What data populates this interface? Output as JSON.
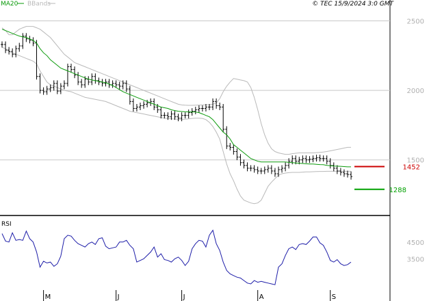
{
  "header": {
    "legend_ma20": "MA20",
    "legend_bbands": "BBands",
    "source": "© TEC 15/9/2024 3:0 GMT"
  },
  "colors": {
    "price": "#000000",
    "ma20": "#0a9a0a",
    "bbands": "#b9b9b9",
    "rsi": "#1c1ca8",
    "resistance": "#cc0000",
    "support": "#00a000",
    "grid": "#c8c8c8",
    "axis_text": "#b0b0b0"
  },
  "chart_data": [
    {
      "type": "ohlc",
      "name": "price",
      "ylim": [
        1100,
        2650
      ],
      "y_ticks": [
        {
          "value": 2500,
          "label": "2500"
        },
        {
          "value": 2000,
          "label": "2000"
        },
        {
          "value": 1500,
          "label": "1500"
        }
      ],
      "x_labels": [
        {
          "label": "M",
          "index": 12
        },
        {
          "label": "J",
          "index": 33
        },
        {
          "label": "J",
          "index": 52
        },
        {
          "label": "A",
          "index": 74
        },
        {
          "label": "S",
          "index": 95
        }
      ],
      "closes": [
        2330,
        2290,
        2280,
        2260,
        2300,
        2320,
        2390,
        2370,
        2360,
        2340,
        2100,
        2000,
        1990,
        2010,
        2020,
        2050,
        1995,
        2030,
        2050,
        2170,
        2150,
        2110,
        2060,
        2040,
        2080,
        2060,
        2100,
        2070,
        2060,
        2050,
        2060,
        2040,
        2050,
        2040,
        2030,
        2050,
        2010,
        1920,
        1870,
        1880,
        1890,
        1900,
        1910,
        1920,
        1880,
        1860,
        1820,
        1820,
        1810,
        1830,
        1810,
        1800,
        1820,
        1820,
        1840,
        1850,
        1860,
        1870,
        1870,
        1880,
        1880,
        1920,
        1890,
        1880,
        1720,
        1600,
        1590,
        1560,
        1520,
        1480,
        1460,
        1440,
        1440,
        1430,
        1420,
        1420,
        1430,
        1440,
        1420,
        1400,
        1430,
        1440,
        1460,
        1490,
        1510,
        1490,
        1500,
        1510,
        1500,
        1505,
        1510,
        1515,
        1510,
        1510,
        1490,
        1460,
        1440,
        1420,
        1410,
        1400,
        1395,
        1380
      ],
      "ma20": [
        2440,
        2430,
        2420,
        2410,
        2400,
        2390,
        2385,
        2380,
        2370,
        2360,
        2340,
        2300,
        2270,
        2250,
        2220,
        2200,
        2180,
        2160,
        2150,
        2140,
        2130,
        2120,
        2110,
        2100,
        2090,
        2080,
        2075,
        2070,
        2065,
        2060,
        2055,
        2045,
        2035,
        2020,
        2005,
        1990,
        1980,
        1970,
        1960,
        1950,
        1940,
        1930,
        1920,
        1910,
        1900,
        1890,
        1880,
        1875,
        1870,
        1860,
        1855,
        1850,
        1848,
        1846,
        1845,
        1845,
        1845,
        1840,
        1830,
        1820,
        1810,
        1790,
        1760,
        1730,
        1700,
        1680,
        1650,
        1610,
        1590,
        1570,
        1550,
        1530,
        1510,
        1500,
        1490,
        1485,
        1485,
        1485,
        1485,
        1485,
        1485,
        1485,
        1485,
        1482,
        1480,
        1478,
        1476,
        1474,
        1472,
        1470,
        1470,
        1468,
        1466,
        1465,
        1460,
        1458,
        1456,
        1455,
        1454,
        1452,
        1450,
        1450
      ],
      "bb_upper": [
        2450,
        2430,
        2400,
        2400,
        2420,
        2440,
        2450,
        2460,
        2460,
        2460,
        2450,
        2440,
        2420,
        2400,
        2380,
        2350,
        2320,
        2290,
        2260,
        2240,
        2220,
        2200,
        2190,
        2180,
        2170,
        2160,
        2150,
        2140,
        2130,
        2120,
        2110,
        2100,
        2090,
        2080,
        2070,
        2060,
        2050,
        2040,
        2030,
        2020,
        2010,
        2000,
        1990,
        1980,
        1970,
        1960,
        1950,
        1940,
        1930,
        1920,
        1910,
        1900,
        1895,
        1893,
        1892,
        1892,
        1893,
        1894,
        1895,
        1896,
        1897,
        1900,
        1910,
        1940,
        1990,
        2030,
        2060,
        2085,
        2080,
        2075,
        2070,
        2060,
        2020,
        1950,
        1860,
        1760,
        1680,
        1620,
        1580,
        1560,
        1550,
        1545,
        1540,
        1540,
        1545,
        1548,
        1550,
        1550,
        1550,
        1550,
        1550,
        1552,
        1554,
        1556,
        1560,
        1565,
        1570,
        1575,
        1580,
        1585,
        1590,
        1590
      ],
      "bb_lower": [
        2310,
        2300,
        2280,
        2270,
        2260,
        2250,
        2240,
        2230,
        2220,
        2210,
        2190,
        2140,
        2100,
        2060,
        2040,
        2030,
        2020,
        2010,
        2000,
        1995,
        1990,
        1980,
        1970,
        1960,
        1950,
        1945,
        1940,
        1935,
        1930,
        1925,
        1920,
        1910,
        1900,
        1890,
        1880,
        1870,
        1860,
        1850,
        1845,
        1840,
        1835,
        1830,
        1825,
        1820,
        1815,
        1810,
        1805,
        1800,
        1798,
        1796,
        1794,
        1792,
        1792,
        1793,
        1795,
        1798,
        1800,
        1800,
        1798,
        1790,
        1770,
        1740,
        1700,
        1650,
        1560,
        1470,
        1400,
        1350,
        1290,
        1240,
        1210,
        1200,
        1190,
        1185,
        1190,
        1210,
        1260,
        1310,
        1340,
        1365,
        1390,
        1400,
        1405,
        1408,
        1410,
        1410,
        1410,
        1412,
        1414,
        1414,
        1415,
        1416,
        1417,
        1417,
        1418,
        1418,
        1418,
        1418,
        1418,
        1418,
        1418,
        1418
      ],
      "resistance": {
        "value": 1452,
        "label": "1452"
      },
      "support": {
        "value": 1288,
        "label": "1288"
      }
    },
    {
      "type": "line",
      "name": "RSI",
      "title": "RSI",
      "ylim": [
        2000,
        6000
      ],
      "y_ticks": [
        {
          "value": 4500,
          "label": "4500"
        },
        {
          "value": 3500,
          "label": "3500"
        }
      ],
      "values": [
        5000,
        4550,
        4500,
        5050,
        4600,
        4650,
        4600,
        5150,
        4700,
        4500,
        3900,
        3000,
        3350,
        3250,
        3300,
        3050,
        3200,
        3650,
        4700,
        4900,
        4850,
        4600,
        4400,
        4300,
        4200,
        4400,
        4500,
        4350,
        4700,
        4750,
        4250,
        4100,
        4150,
        4200,
        4500,
        4500,
        4600,
        4300,
        4100,
        3300,
        3400,
        3500,
        3700,
        3900,
        4200,
        3600,
        3800,
        3450,
        3400,
        3300,
        3500,
        3600,
        3400,
        3100,
        3350,
        4100,
        4400,
        4600,
        4550,
        4200,
        4900,
        5200,
        4400,
        4000,
        3300,
        2800,
        2600,
        2500,
        2400,
        2350,
        2200,
        2050,
        2000,
        2200,
        2100,
        2150,
        2100,
        2050,
        2000,
        1950,
        3000,
        3200,
        3700,
        4100,
        4200,
        4050,
        4350,
        4400,
        4350,
        4550,
        4800,
        4800,
        4450,
        4300,
        3900,
        3400,
        3300,
        3450,
        3200,
        3100,
        3150,
        3300
      ]
    }
  ]
}
